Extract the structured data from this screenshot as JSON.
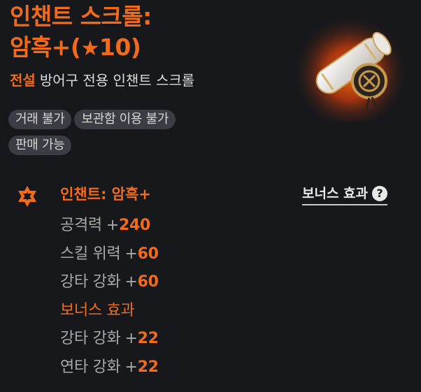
{
  "item": {
    "title_line1": "인챈트 스크롤:",
    "title_line2_prefix": "암흑+(",
    "title_star": "★",
    "title_line2_level": "10",
    "title_line2_suffix": ")",
    "grade": "전설",
    "description": "방어구 전용 인챈트 스크롤"
  },
  "tags": [
    "거래 불가",
    "보관함 이용 불가",
    "판매 가능"
  ],
  "enchant": {
    "name": "인챈트: 암흑+",
    "bonus_link_label": "보너스 효과",
    "help_icon": "?"
  },
  "stats": [
    {
      "label": "공격력",
      "sign": "+",
      "value": "240"
    },
    {
      "label": "스킬 위력",
      "sign": "+",
      "value": "60"
    },
    {
      "label": "강타 강화",
      "sign": "+",
      "value": "60"
    }
  ],
  "bonus": {
    "title": "보너스 효과",
    "stats": [
      {
        "label": "강타 강화",
        "sign": "+",
        "value": "22"
      },
      {
        "label": "연타 강화",
        "sign": "+",
        "value": "22"
      }
    ]
  },
  "colors": {
    "accent": "#f26b1d",
    "background": "#17181c",
    "tag_bg": "#3a3d44"
  },
  "icons": {
    "item_image": "scroll-icon",
    "enchant_icon": "hexagram-icon"
  }
}
